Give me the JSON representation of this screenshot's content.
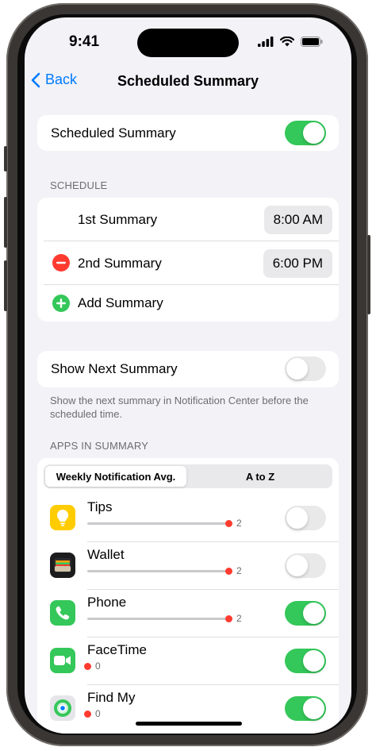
{
  "status": {
    "time": "9:41"
  },
  "nav": {
    "back_label": "Back",
    "title": "Scheduled Summary"
  },
  "summary_toggle": {
    "label": "Scheduled Summary",
    "on": true
  },
  "schedule": {
    "header": "SCHEDULE",
    "items": [
      {
        "label": "1st Summary",
        "time": "8:00 AM"
      },
      {
        "label": "2nd Summary",
        "time": "6:00 PM"
      }
    ],
    "add_label": "Add Summary"
  },
  "next_summary": {
    "label": "Show Next Summary",
    "on": false,
    "footer": "Show the next summary in Notification Center before the scheduled time."
  },
  "apps": {
    "header": "APPS IN SUMMARY",
    "sort_options": [
      "Weekly Notification Avg.",
      "A to Z"
    ],
    "selected_sort": "Weekly Notification Avg.",
    "list": [
      {
        "name": "Tips",
        "count": "2",
        "on": false,
        "icon": "lightbulb-icon",
        "color": "#ffcc00"
      },
      {
        "name": "Wallet",
        "count": "2",
        "on": false,
        "icon": "wallet-icon",
        "color": "#1c1c1e"
      },
      {
        "name": "Phone",
        "count": "2",
        "on": true,
        "icon": "phone-icon",
        "color": "#34c759"
      },
      {
        "name": "FaceTime",
        "count": "0",
        "on": true,
        "icon": "video-camera-icon",
        "color": "#34c759"
      },
      {
        "name": "Find My",
        "count": "0",
        "on": true,
        "icon": "location-icon",
        "color": "#e5e5ea"
      }
    ]
  },
  "colors": {
    "accent": "#007aff",
    "toggle_on": "#34c759",
    "destructive": "#ff3b30",
    "background": "#f2f2f7"
  }
}
